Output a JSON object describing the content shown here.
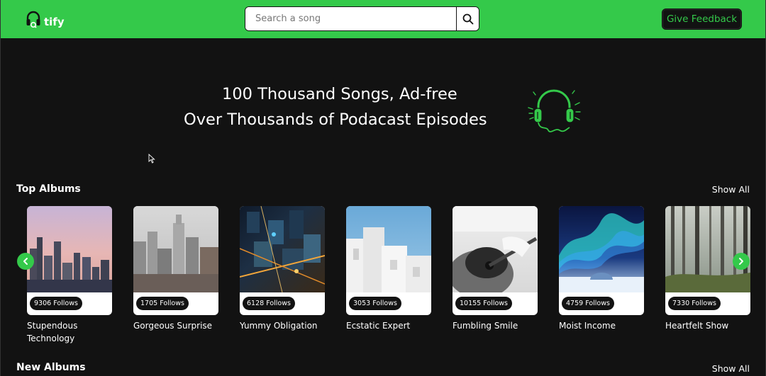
{
  "app": {
    "logo_text": "tify",
    "search_placeholder": "Search a song",
    "feedback_label": "Give Feedback",
    "colors": {
      "brand_green": "#34c94a",
      "background": "#121212"
    }
  },
  "hero": {
    "line1": "100 Thousand Songs, Ad-free",
    "line2": "Over Thousands of Podacast Episodes",
    "art_icon": "headphones-icon"
  },
  "top_albums": {
    "title": "Top Albums",
    "show_all": "Show All",
    "items": [
      {
        "follows": "9306 Follows",
        "title": "Stupendous Technology"
      },
      {
        "follows": "1705 Follows",
        "title": "Gorgeous Surprise"
      },
      {
        "follows": "6128 Follows",
        "title": "Yummy Obligation"
      },
      {
        "follows": "3053 Follows",
        "title": "Ecstatic Expert"
      },
      {
        "follows": "10155 Follows",
        "title": "Fumbling Smile"
      },
      {
        "follows": "4759 Follows",
        "title": "Moist Income"
      },
      {
        "follows": "7330 Follows",
        "title": "Heartfelt Show"
      }
    ]
  },
  "new_albums": {
    "title": "New Albums",
    "show_all": "Show All"
  }
}
